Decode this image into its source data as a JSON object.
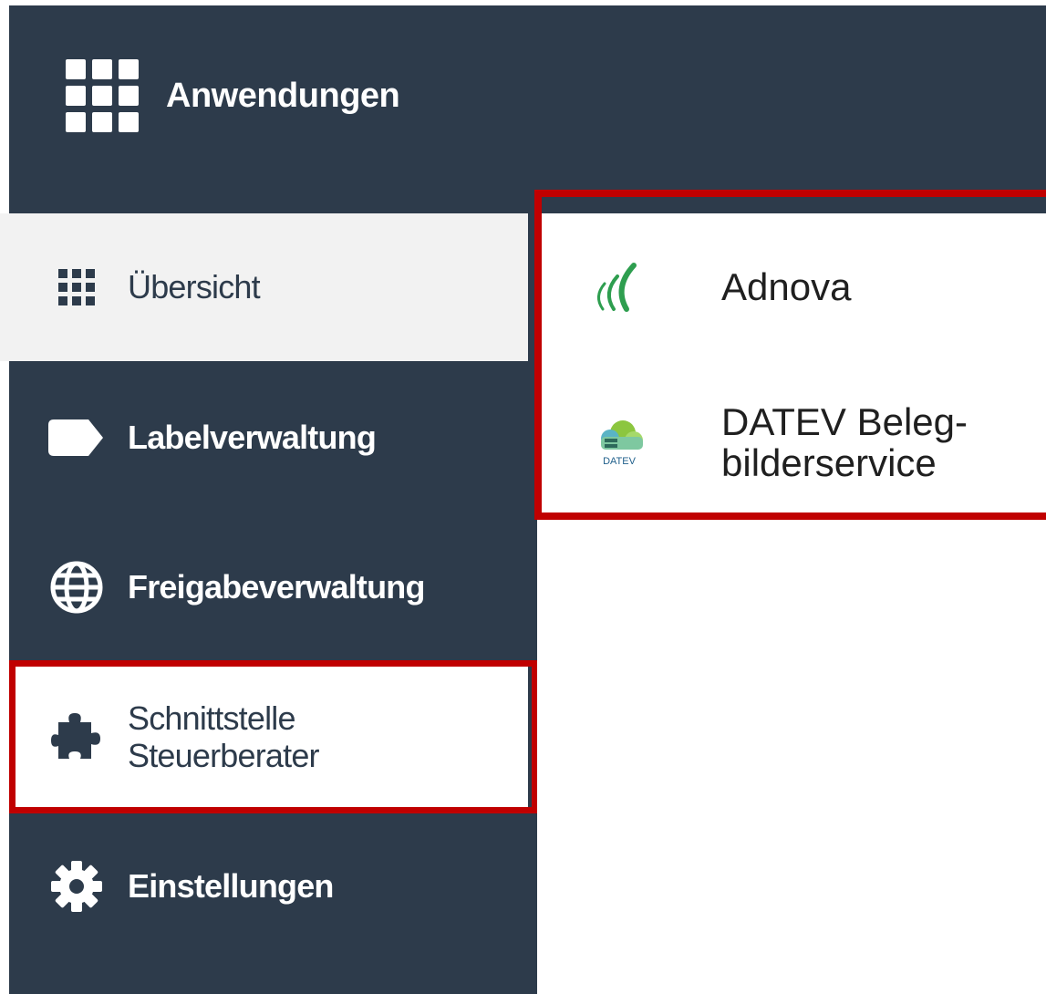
{
  "header": {
    "apps_label": "Anwendungen",
    "apps_icon": "grid-icon"
  },
  "sidebar": {
    "items": [
      {
        "label": "Übersicht",
        "icon": "grid-icon",
        "state": "active"
      },
      {
        "label": "Labelverwaltung",
        "icon": "label-icon"
      },
      {
        "label": "Freigabeverwaltung",
        "icon": "globe-icon"
      },
      {
        "label": "Schnittstelle Steuerberater",
        "icon": "puzzle-icon",
        "state": "highlighted"
      },
      {
        "label": "Einstellungen",
        "icon": "gear-icon"
      }
    ]
  },
  "apps": [
    {
      "name": "Adnova",
      "logo": "adnova-logo"
    },
    {
      "name": "DATEV Beleg-bilderservice",
      "logo": "datev-cloud-logo",
      "logo_text": "DATEV"
    }
  ],
  "colors": {
    "sidebar_bg": "#2d3b4b",
    "active_bg": "#f2f2f2",
    "highlight_border": "#c00000",
    "adnova_green": "#2e9e4f"
  }
}
